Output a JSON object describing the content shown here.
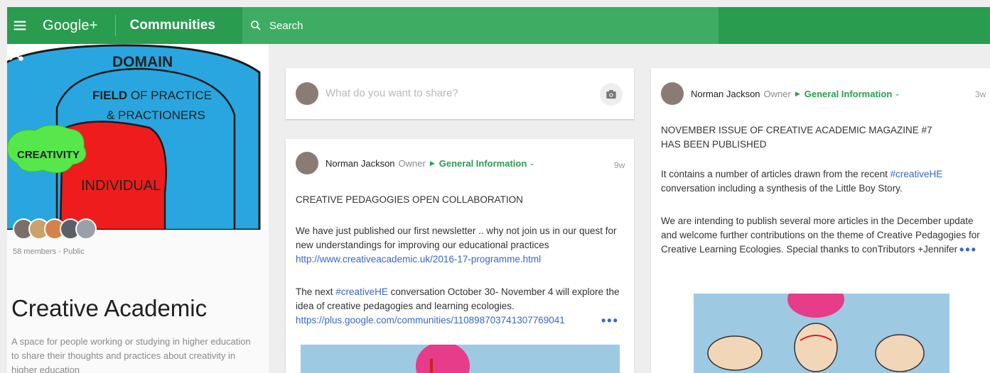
{
  "topbar": {
    "brand": "Google+",
    "section": "Communities",
    "search_placeholder": "Search"
  },
  "community": {
    "cover_labels": {
      "domain": "DOMAIN",
      "field": "FIELD OF PRACTICE",
      "field_bold": "FIELD",
      "field_rest": " OF PRACTICE",
      "practioners": "& PRACTIONERS",
      "creativity": "CREATIVITY",
      "individual": "INDIVIDUAL"
    },
    "members": "58 members - Public",
    "title": "Creative Academic",
    "description": "A space for people working or studying in higher education to share their thoughts and practices about creativity in higher education"
  },
  "share_box": {
    "prompt": "What do you want to share?"
  },
  "posts": [
    {
      "author": "Norman Jackson",
      "role": "Owner",
      "category": "General Information",
      "age": "9w",
      "title": "CREATIVE PEDAGOGIES OPEN COLLABORATION",
      "para1": "We have just published our first newsletter .. why not join us in our quest for new understandings for improving our educational practices",
      "link1": "http://www.creativeacademic.uk/2016-17-programme.html",
      "para2_a": "The next",
      "hashtag": "#creativeHE",
      "para2_b": "conversation October 30- November 4 will explore the idea of creative pedagogies and learning ecologies.",
      "link2": "https://plus.google.com/communities/110898703741307769041"
    },
    {
      "author": "Norman Jackson",
      "role": "Owner",
      "category": "General Information",
      "age": "3w",
      "title_line1": "NOVEMBER ISSUE OF CREATIVE ACADEMIC MAGAZINE #7",
      "title_line2": "HAS BEEN PUBLISHED",
      "para1_a": "It contains a number of articles drawn from the recent",
      "hashtag": "#creativeHE",
      "para1_b": "conversation including a synthesis of the Little Boy Story.",
      "para2": "We are intending to publish several more articles in the December update and welcome further contributions on the theme of Creative Pedagogies for Creative Learning Ecologies. Special thanks to conTributors +Jennifer Willis +Simo"
    }
  ],
  "icons": {
    "menu": "menu-icon",
    "search": "search-icon",
    "share": "share-icon",
    "more": "more-vert-icon",
    "camera": "camera-icon",
    "expand": "chevron-down-icon"
  },
  "colors": {
    "brand_green": "#299c4f",
    "search_green": "#3fac64",
    "link_blue": "#3a67c7"
  }
}
